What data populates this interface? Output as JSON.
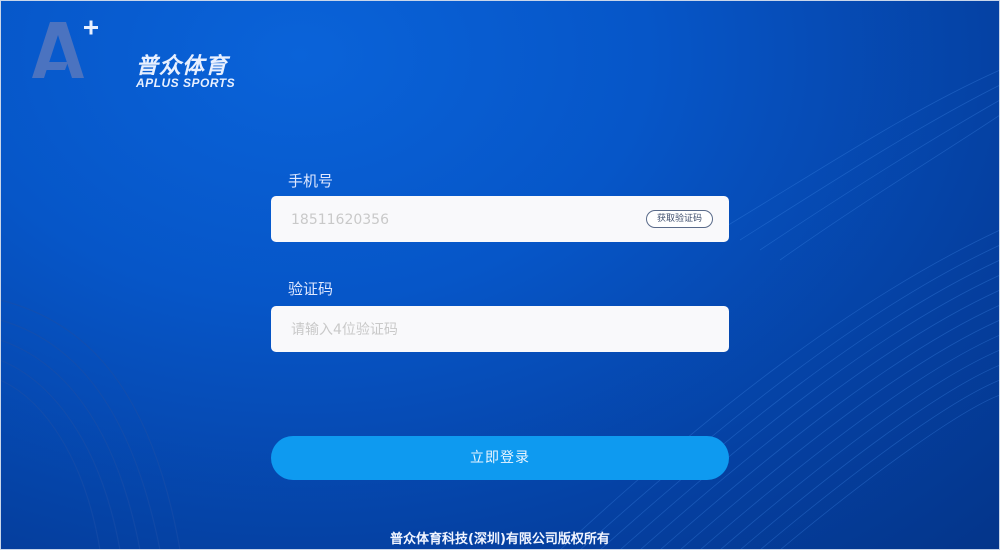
{
  "brand": {
    "name_cn": "普众体育",
    "name_en": "APLUS SPORTS",
    "mark_letter": "A",
    "mark_plus": "+"
  },
  "form": {
    "phone_label": "手机号",
    "phone_placeholder": "18511620356",
    "get_code_label": "获取验证码",
    "code_label": "验证码",
    "code_placeholder": "请输入4位验证码",
    "submit_label": "立即登录"
  },
  "footer": {
    "copyright": "普众体育科技(深圳)有限公司版权所有"
  },
  "colors": {
    "background": "#0656c8",
    "submit": "#0e9af0",
    "field": "#f9f9fb"
  }
}
